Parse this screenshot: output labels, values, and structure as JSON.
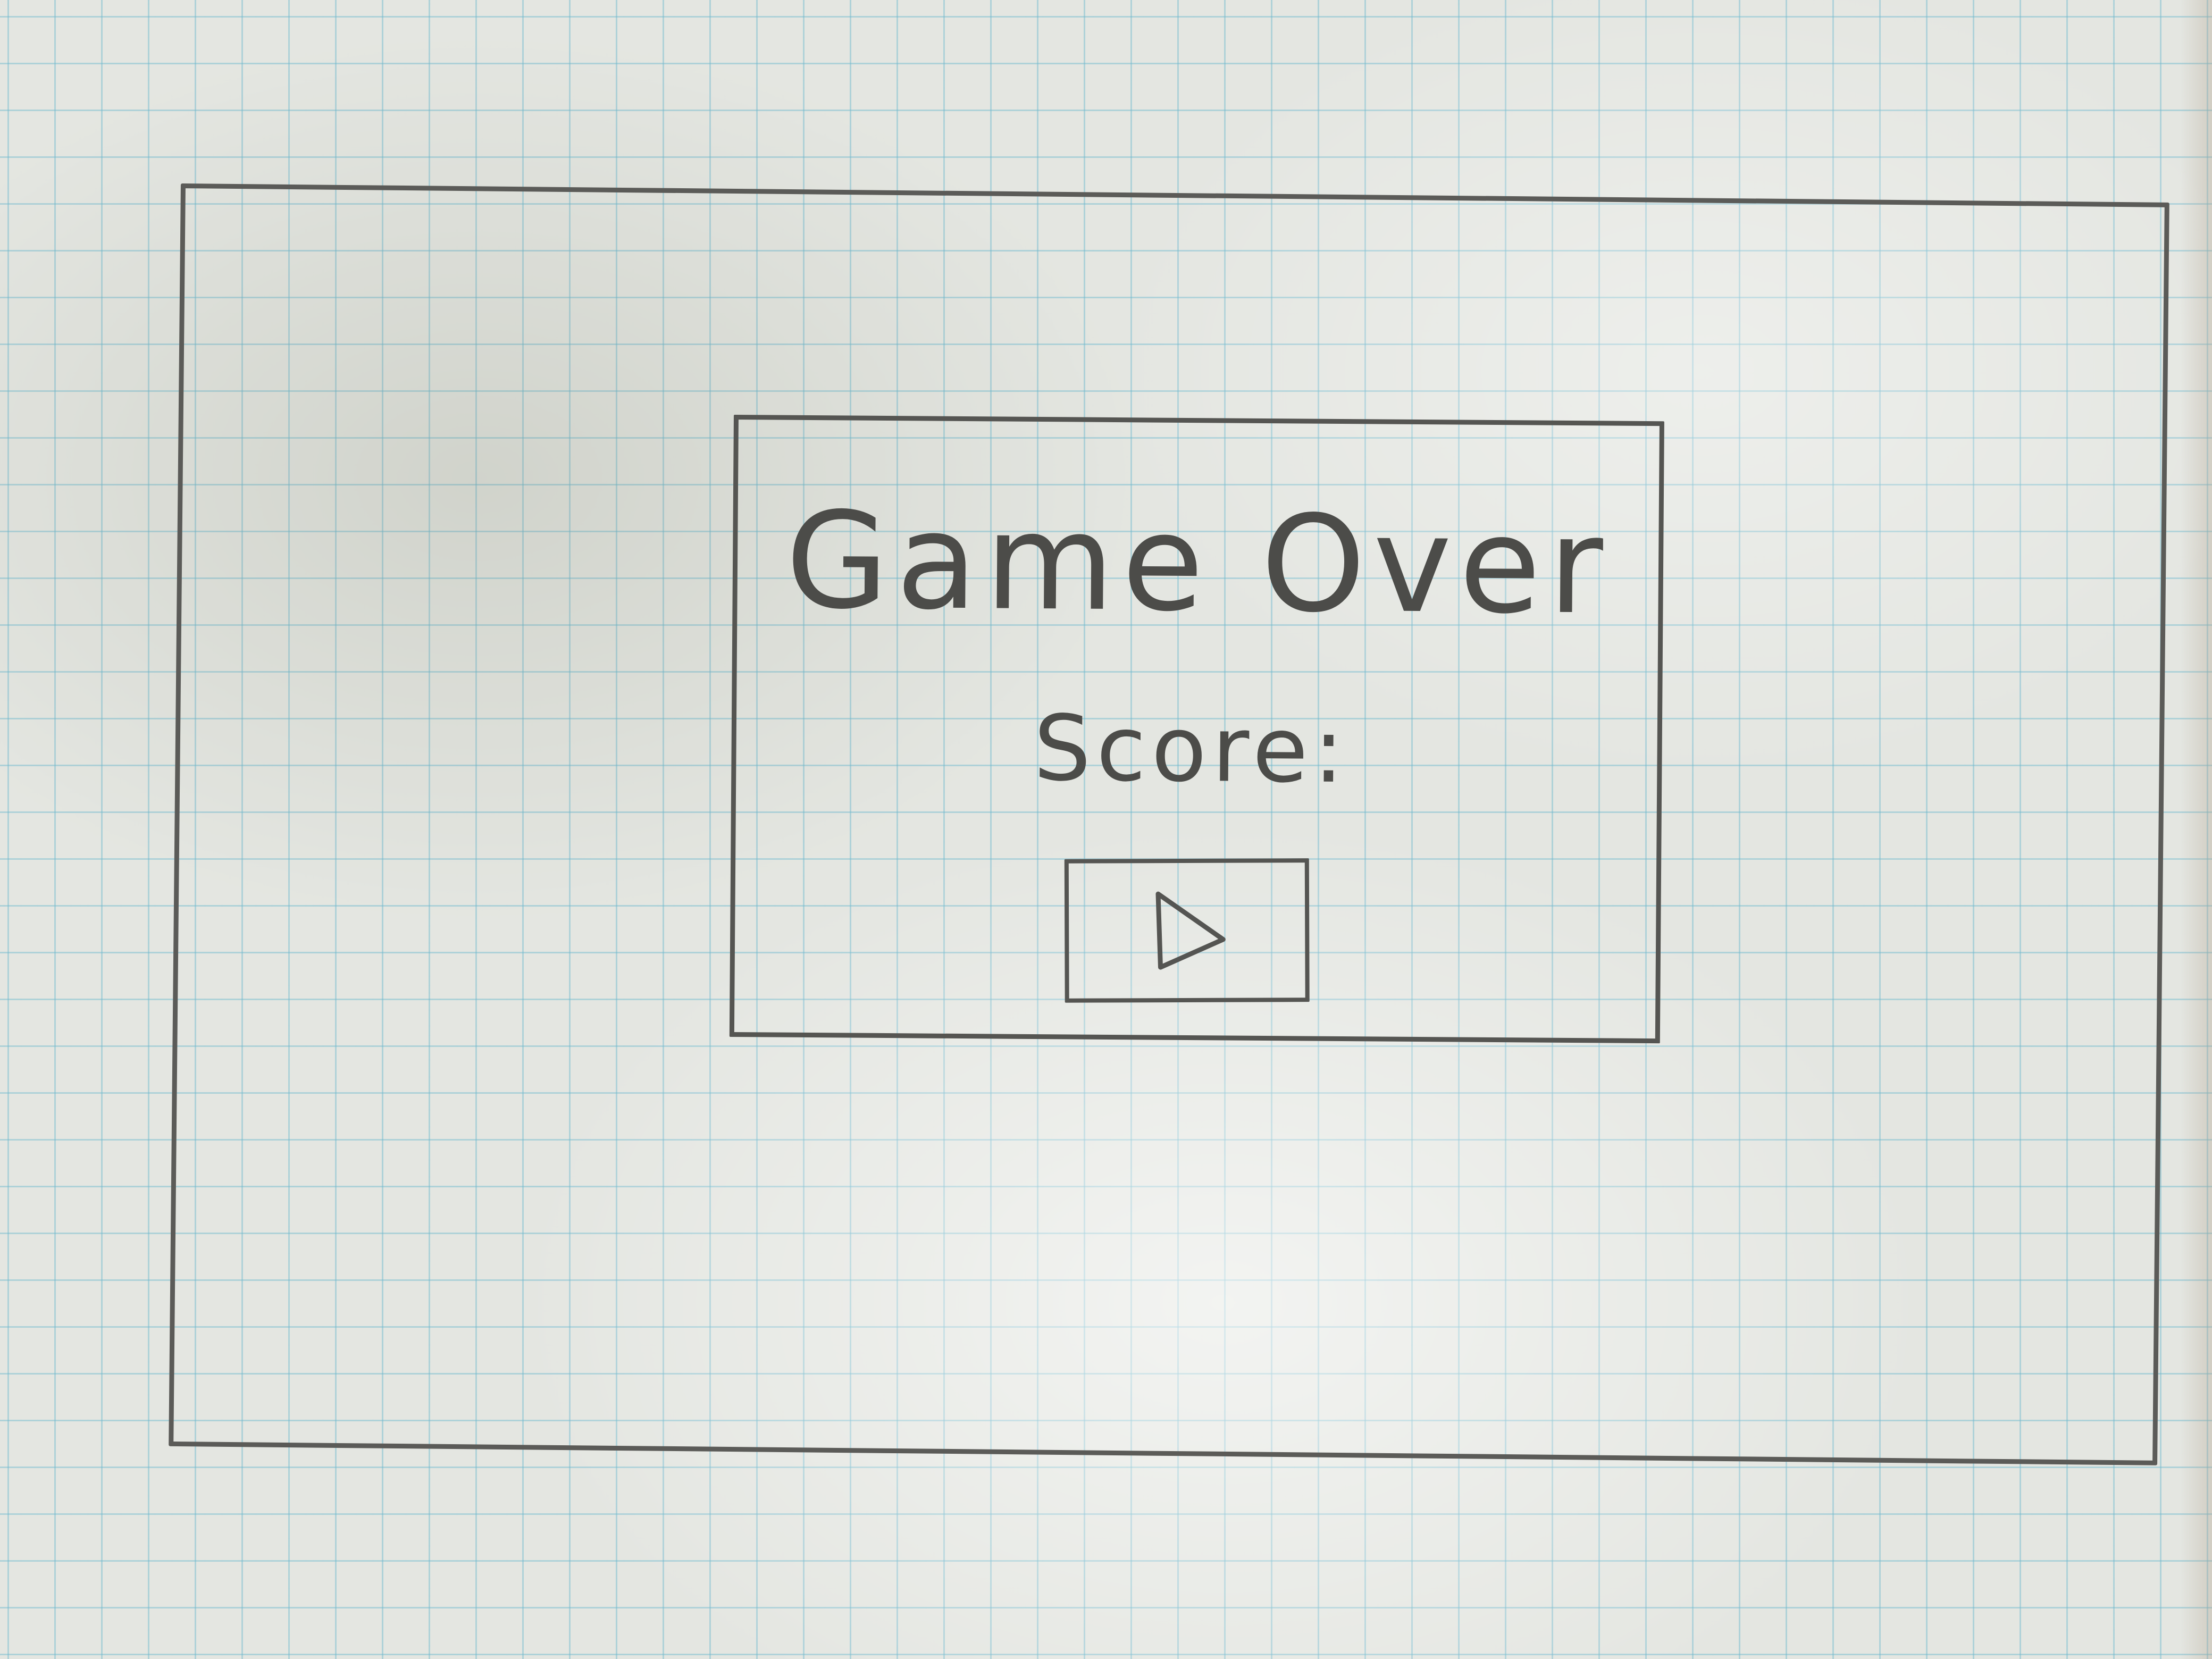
{
  "dialog": {
    "title": "Game Over",
    "score_label": "Score:",
    "score_value": ""
  },
  "play_button": {
    "icon": "play-icon"
  },
  "colors": {
    "pencil": "#555552",
    "paper": "#e4e6e1",
    "grid": "#6eb9cd"
  }
}
